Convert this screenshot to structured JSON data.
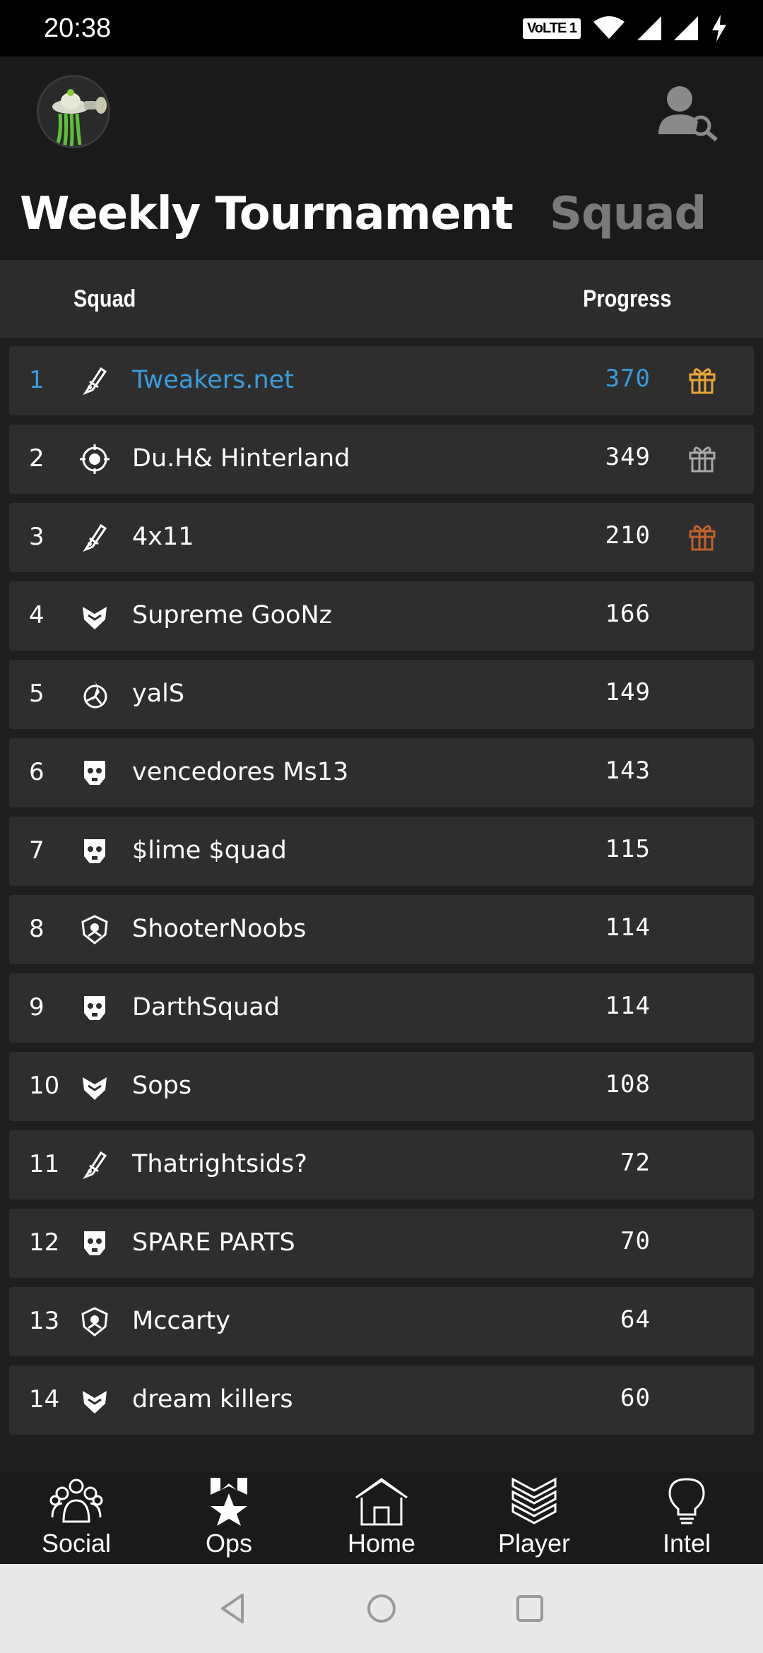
{
  "status_bar": {
    "time": "20:38",
    "volte": "VoLTE 1"
  },
  "header": {
    "avatar_icon": "alien-player-avatar",
    "search_icon": "player-search-icon"
  },
  "tabs": [
    {
      "label": "Weekly Tournament",
      "active": true
    },
    {
      "label": "Squad",
      "active": false
    }
  ],
  "table": {
    "col_squad": "Squad",
    "col_progress": "Progress"
  },
  "colors": {
    "accent": "#3a9bdc",
    "gift_gold": "#e8a53a",
    "gift_silver": "#a8a8a8",
    "gift_bronze": "#c0622e"
  },
  "rows": [
    {
      "rank": "1",
      "name": "Tweakers.net",
      "score": "370",
      "icon": "rifle-emblem-icon",
      "gift": "gold"
    },
    {
      "rank": "2",
      "name": "Du.H& Hinterland",
      "score": "349",
      "icon": "target-emblem-icon",
      "gift": "silver"
    },
    {
      "rank": "3",
      "name": "4x11",
      "score": "210",
      "icon": "rifle-emblem-icon",
      "gift": "bronze"
    },
    {
      "rank": "4",
      "name": "Supreme GooNz",
      "score": "166",
      "icon": "wings-emblem-icon",
      "gift": null
    },
    {
      "rank": "5",
      "name": "yalS",
      "score": "149",
      "icon": "claw-emblem-icon",
      "gift": null
    },
    {
      "rank": "6",
      "name": "vencedores Ms13",
      "score": "143",
      "icon": "skull-emblem-icon",
      "gift": null
    },
    {
      "rank": "7",
      "name": "$lime $quad",
      "score": "115",
      "icon": "skull-emblem-icon",
      "gift": null
    },
    {
      "rank": "8",
      "name": "ShooterNoobs",
      "score": "114",
      "icon": "shield-emblem-icon",
      "gift": null
    },
    {
      "rank": "9",
      "name": "DarthSquad",
      "score": "114",
      "icon": "skull-emblem-icon",
      "gift": null
    },
    {
      "rank": "10",
      "name": "Sops",
      "score": "108",
      "icon": "wings-emblem-icon",
      "gift": null
    },
    {
      "rank": "11",
      "name": "Thatrightsids?",
      "score": "72",
      "icon": "rifle-emblem-icon",
      "gift": null
    },
    {
      "rank": "12",
      "name": "SPARE PARTS",
      "score": "70",
      "icon": "skull-emblem-icon",
      "gift": null
    },
    {
      "rank": "13",
      "name": "Mccarty",
      "score": "64",
      "icon": "shield-emblem-icon",
      "gift": null
    },
    {
      "rank": "14",
      "name": "dream killers",
      "score": "60",
      "icon": "wings-emblem-icon",
      "gift": null
    }
  ],
  "bottom_nav": [
    {
      "label": "Social",
      "icon": "social-group-icon"
    },
    {
      "label": "Ops",
      "icon": "ops-star-icon"
    },
    {
      "label": "Home",
      "icon": "home-icon"
    },
    {
      "label": "Player",
      "icon": "player-chevrons-icon"
    },
    {
      "label": "Intel",
      "icon": "lightbulb-icon"
    }
  ]
}
